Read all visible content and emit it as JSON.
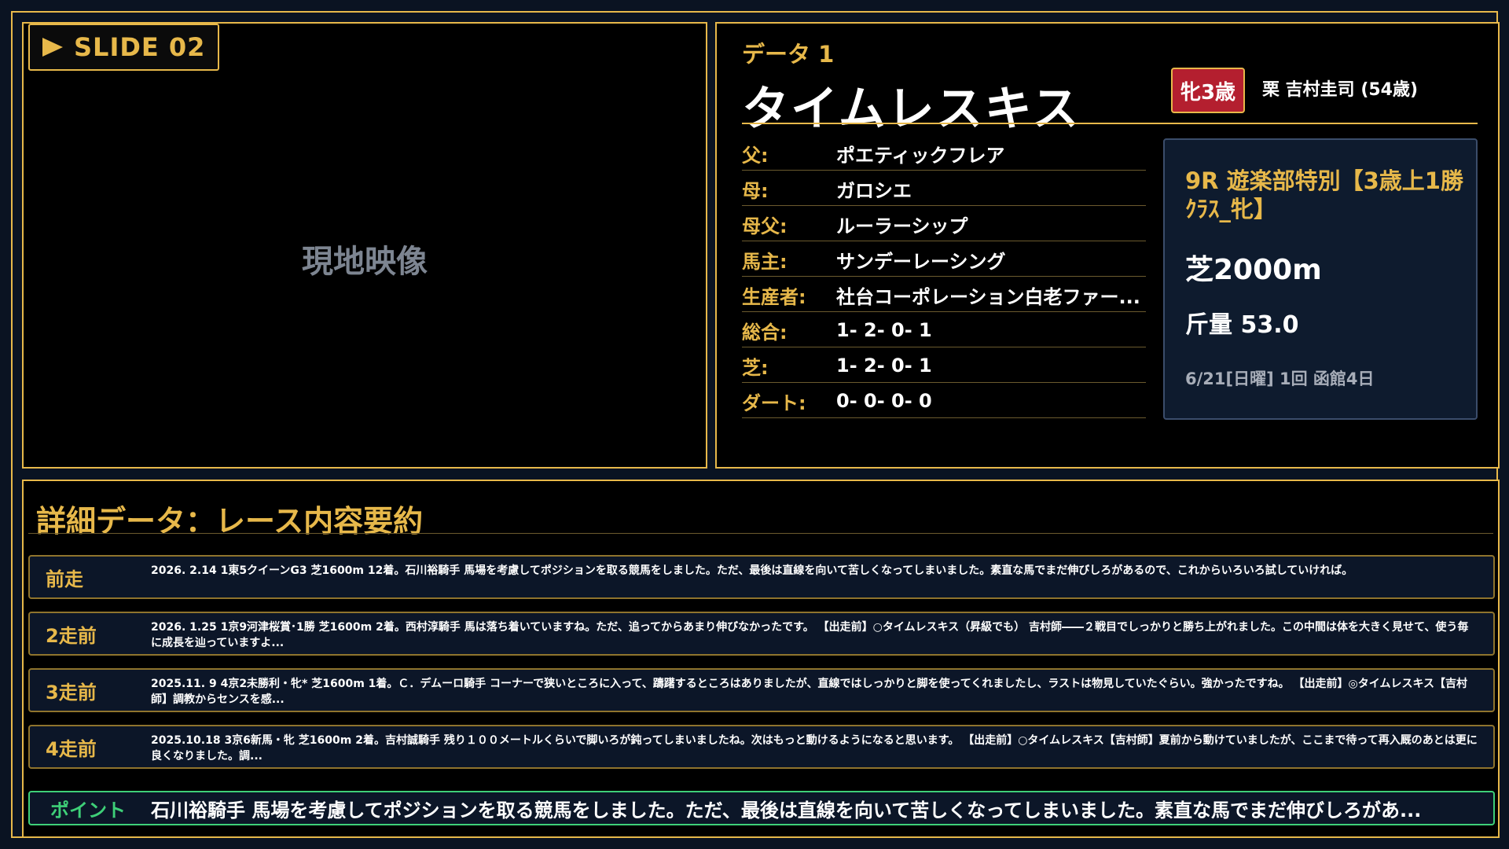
{
  "video": {
    "slide_label": "SLIDE 02",
    "placeholder": "現地映像"
  },
  "horse": {
    "data_tag": "データ 1",
    "name": "タイムレスキス",
    "sex_age": "牝3歳",
    "trainer": "栗 吉村圭司 (54歳)",
    "pedigree": [
      {
        "label": "父:",
        "value": "ポエティックフレア"
      },
      {
        "label": "母:",
        "value": "ガロシエ"
      },
      {
        "label": "母父:",
        "value": "ルーラーシップ"
      },
      {
        "label": "馬主:",
        "value": "サンデーレーシング"
      },
      {
        "label": "生産者:",
        "value": "社台コーポレーション白老ファー..."
      },
      {
        "label": "総合:",
        "value": "1- 2- 0- 1"
      },
      {
        "label": "芝:",
        "value": "1- 2- 0- 1"
      },
      {
        "label": "ダート:",
        "value": "0- 0- 0- 0"
      }
    ]
  },
  "race": {
    "title": "9R 遊楽部特別【3歳上1勝ｸﾗｽ_牝】",
    "distance": "芝2000m",
    "weight": "斤量 53.0",
    "date": "6/21[日曜] 1回 函館4日"
  },
  "detail": {
    "title": "詳細データ：レース内容要約",
    "rows": [
      {
        "label": "前走",
        "text": "2026. 2.14 1東5クイーンG3 芝1600m 12着。石川裕騎手 馬場を考慮してポジションを取る競馬をしました。ただ、最後は直線を向いて苦しくなってしまいました。素直な馬でまだ伸びしろがあるので、これからいろいろ試していければ。"
      },
      {
        "label": "2走前",
        "text": "2026. 1.25 1京9河津桜賞･1勝 芝1600m 2着。西村淳騎手 馬は落ち着いていますね。ただ、追ってからあまり伸びなかったです。 【出走前】○タイムレスキス（昇級でも） 吉村師――２戦目でしっかりと勝ち上がれました。この中間は体を大きく見せて、使う毎に成長を辿っていますよ..."
      },
      {
        "label": "3走前",
        "text": "2025.11. 9 4京2未勝利・牝* 芝1600m 1着。Ｃ．デムーロ騎手 コーナーで狭いところに入って、躊躇するところはありましたが、直線ではしっかりと脚を使ってくれましたし、ラストは物見していたぐらい。強かったですね。 【出走前】◎タイムレスキス【吉村師】調教からセンスを感..."
      },
      {
        "label": "4走前",
        "text": "2025.10.18 3京6新馬・牝 芝1600m 2着。吉村誠騎手 残り１００メートルくらいで脚いろが鈍ってしまいましたね。次はもっと動けるようになると思います。 【出走前】○タイムレスキス【吉村師】夏前から動けていましたが、ここまで待って再入厩のあとは更に良くなりました。調..."
      }
    ],
    "point_label": "ポイント",
    "point_text": "石川裕騎手 馬場を考慮してポジションを取る競馬をしました。ただ、最後は直線を向いて苦しくなってしまいました。素直な馬でまだ伸びしろがあ..."
  },
  "colors": {
    "accent": "#e7b84a",
    "badge_red": "#b41f2f",
    "point_green": "#3ecf78",
    "background": "#0a1322"
  }
}
